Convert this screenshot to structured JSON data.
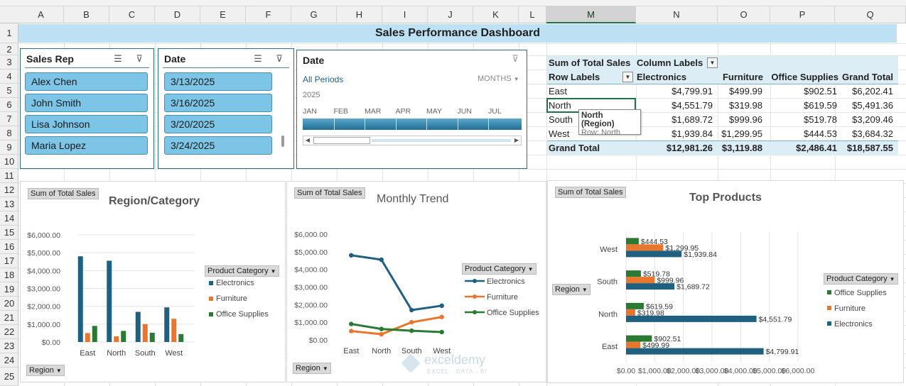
{
  "columns": [
    "A",
    "B",
    "C",
    "D",
    "E",
    "F",
    "G",
    "H",
    "I",
    "J",
    "K",
    "L",
    "M",
    "N",
    "O",
    "P",
    "Q"
  ],
  "selected_column": "M",
  "rows": [
    "1",
    "2",
    "3",
    "4",
    "5",
    "6",
    "7",
    "8",
    "9",
    "10",
    "11",
    "12",
    "13",
    "14",
    "15",
    "16",
    "17",
    "18",
    "19",
    "20",
    "21",
    "22",
    "23",
    "24",
    "25"
  ],
  "dashboard_title": "Sales Performance Dashboard",
  "slicer_sales_rep": {
    "header": "Sales Rep",
    "items": [
      "Alex Chen",
      "John Smith",
      "Lisa Johnson",
      "Maria Lopez"
    ]
  },
  "slicer_date": {
    "header": "Date",
    "items": [
      "3/13/2025",
      "3/16/2025",
      "3/20/2025",
      "3/24/2025"
    ]
  },
  "timeline": {
    "header": "Date",
    "periods_label": "All Periods",
    "level_label": "MONTHS",
    "year": "2025",
    "months": [
      "JAN",
      "FEB",
      "MAR",
      "APR",
      "MAY",
      "JUN",
      "JUL"
    ]
  },
  "pivot": {
    "corner_label": "Sum of Total Sales",
    "column_labels": "Column Labels",
    "row_labels": "Row Labels",
    "headers": [
      "Electronics",
      "Furniture",
      "Office Supplies",
      "Grand Total"
    ],
    "rows": [
      {
        "label": "East",
        "values": [
          "$4,799.91",
          "$499.99",
          "$902.51",
          "$6,202.41"
        ]
      },
      {
        "label": "North",
        "values": [
          "$4,551.79",
          "$319.98",
          "$619.59",
          "$5,491.36"
        ]
      },
      {
        "label": "South",
        "values": [
          "$1,689.72",
          "$999.96",
          "$519.78",
          "$3,209.46"
        ]
      },
      {
        "label": "West",
        "values": [
          "$1,939.84",
          "$1,299.95",
          "$444.53",
          "$3,684.32"
        ]
      }
    ],
    "total": {
      "label": "Grand Total",
      "values": [
        "$12,981.26",
        "$3,119.88",
        "$2,486.41",
        "$18,587.55"
      ]
    },
    "tooltip_title": "North (Region)",
    "tooltip_sub": "Row: North"
  },
  "chart_buttons": {
    "value_field": "Sum of Total Sales",
    "axis_field": "Region",
    "legend_field": "Product Category"
  },
  "colors": {
    "electronics": "#1f5f7f",
    "furniture": "#e8762d",
    "office": "#2b7a33"
  },
  "chart_data": [
    {
      "type": "bar",
      "title": "Region/Category",
      "categories": [
        "East",
        "North",
        "South",
        "West"
      ],
      "series": [
        {
          "name": "Electronics",
          "values": [
            4799.91,
            4551.79,
            1689.72,
            1939.84
          ]
        },
        {
          "name": "Furniture",
          "values": [
            499.99,
            319.98,
            999.96,
            1299.95
          ]
        },
        {
          "name": "Office Supplies",
          "values": [
            902.51,
            619.59,
            519.78,
            444.53
          ]
        }
      ],
      "ylim": [
        0,
        6000
      ],
      "yticks": [
        "$0.00",
        "$1,000.00",
        "$2,000.00",
        "$3,000.00",
        "$4,000.00",
        "$5,000.00",
        "$6,000.00"
      ],
      "legend": "right"
    },
    {
      "type": "line",
      "title": "Monthly Trend",
      "categories": [
        "East",
        "North",
        "South",
        "West"
      ],
      "series": [
        {
          "name": "Electronics",
          "values": [
            4799.91,
            4551.79,
            1689.72,
            1939.84
          ]
        },
        {
          "name": "Furniture",
          "values": [
            499.99,
            319.98,
            999.96,
            1299.95
          ]
        },
        {
          "name": "Office Supplies",
          "values": [
            902.51,
            619.59,
            519.78,
            444.53
          ]
        }
      ],
      "ylim": [
        0,
        6000
      ],
      "yticks": [
        "$0.00",
        "$1,000.00",
        "$2,000.00",
        "$3,000.00",
        "$4,000.00",
        "$5,000.00",
        "$6,000.00"
      ],
      "legend": "right"
    },
    {
      "type": "bar",
      "orientation": "horizontal",
      "title": "Top Products",
      "categories": [
        "East",
        "North",
        "South",
        "West"
      ],
      "series": [
        {
          "name": "Office Supplies",
          "values": [
            902.51,
            619.59,
            519.78,
            444.53
          ],
          "labels": [
            "$902.51",
            "$619.59",
            "$519.78",
            "$444.53"
          ]
        },
        {
          "name": "Furniture",
          "values": [
            499.99,
            319.98,
            999.96,
            1299.95
          ],
          "labels": [
            "$499.99",
            "$319.98",
            "$999.96",
            "$1,299.95"
          ]
        },
        {
          "name": "Electronics",
          "values": [
            4799.91,
            4551.79,
            1689.72,
            1939.84
          ],
          "labels": [
            "$4,799.91",
            "$4,551.79",
            "$1,689.72",
            "$1,939.84"
          ]
        }
      ],
      "xlim": [
        0,
        6000
      ],
      "xticks": [
        "$0.00",
        "$1,000.00",
        "$2,000.00",
        "$3,000.00",
        "$4,000.00",
        "$5,000.00",
        "$6,000.00"
      ],
      "legend": "right"
    }
  ],
  "watermark": {
    "brand": "exceldemy",
    "tagline": "EXCEL · DATA · BI"
  }
}
